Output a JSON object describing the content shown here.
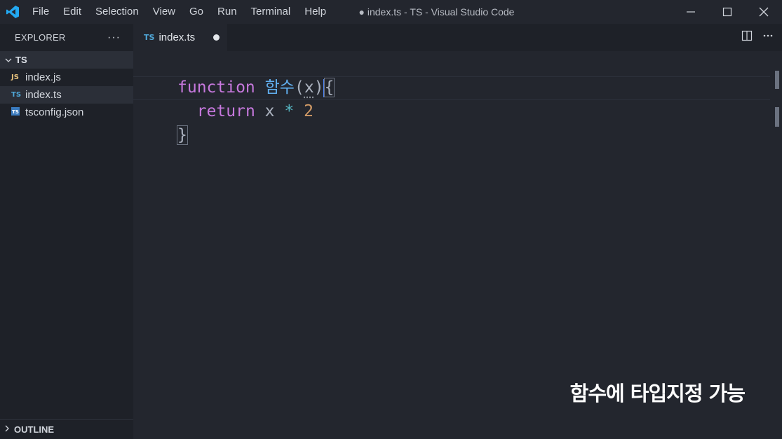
{
  "titlebar": {
    "menu": [
      "File",
      "Edit",
      "Selection",
      "View",
      "Go",
      "Run",
      "Terminal",
      "Help"
    ],
    "window_title": "● index.ts - TS - Visual Studio Code"
  },
  "sidebar": {
    "title": "EXPLORER",
    "more": "···",
    "folder": "TS",
    "files": [
      {
        "icon": "JS",
        "icon_color": "#e5c07b",
        "label": "index.js"
      },
      {
        "icon": "TS",
        "icon_color": "#4fa7d8",
        "label": "index.ts"
      },
      {
        "icon": "TS",
        "icon_color": "#4fa7d8",
        "label": "tsconfig.json"
      }
    ],
    "outline": "OUTLINE"
  },
  "tab": {
    "icon": "TS",
    "label": "index.ts"
  },
  "editor": {
    "line1": {
      "kw": "function",
      "name": "함수",
      "open": "(",
      "param": "x",
      "close": ")",
      "brace": "{"
    },
    "line2": {
      "kw": "return",
      "var": "x",
      "op": "*",
      "num": "2"
    },
    "line3": {
      "brace": "}"
    }
  },
  "caption": "함수에 타입지정 가능",
  "colors": {
    "accent": "#23a9f2",
    "keyword": "#c678dd",
    "function": "#61afef"
  }
}
